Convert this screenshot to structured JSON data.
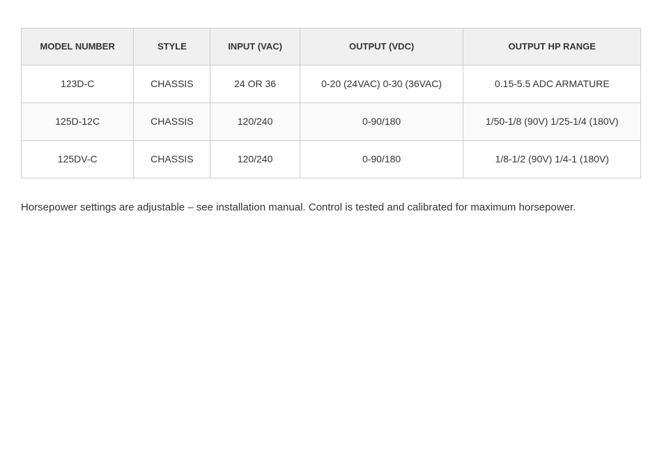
{
  "table": {
    "headers": [
      "MODEL NUMBER",
      "STYLE",
      "INPUT (VAC)",
      "OUTPUT (VDC)",
      "OUTPUT HP RANGE"
    ],
    "rows": [
      {
        "model": "123D-C",
        "style": "CHASSIS",
        "input": "24 OR 36",
        "output_vdc": "0-20 (24VAC) 0-30 (36VAC)",
        "output_hp": "0.15-5.5 ADC ARMATURE"
      },
      {
        "model": "125D-12C",
        "style": "CHASSIS",
        "input": "120/240",
        "output_vdc": "0-90/180",
        "output_hp": "1/50-1/8 (90V) 1/25-1/4 (180V)"
      },
      {
        "model": "125DV-C",
        "style": "CHASSIS",
        "input": "120/240",
        "output_vdc": "0-90/180",
        "output_hp": "1/8-1/2 (90V) 1/4-1 (180V)"
      }
    ]
  },
  "note": "Horsepower settings are adjustable – see installation manual. Control is tested and calibrated for maximum horsepower."
}
